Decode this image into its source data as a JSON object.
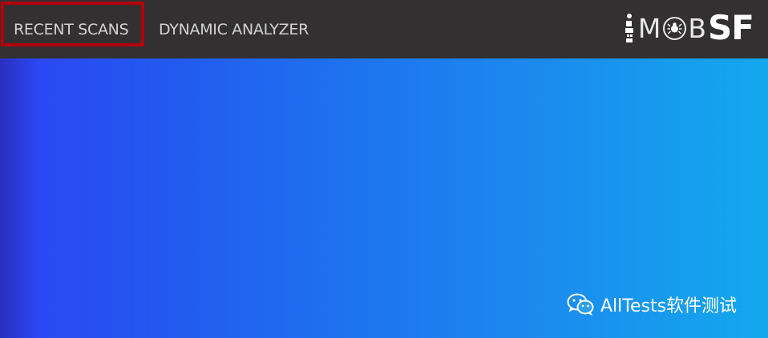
{
  "navbar": {
    "items": [
      {
        "label": "RECENT SCANS",
        "highlighted": true
      },
      {
        "label": "DYNAMIC ANALYZER",
        "highlighted": false
      }
    ],
    "logo": {
      "mob": "MOB",
      "sf": "SF"
    },
    "background_color": "#323031",
    "highlight_color": "#b3000a"
  },
  "hero": {
    "gradient_colors": [
      "#2b2fc0",
      "#2b48f4",
      "#1e72ef",
      "#13a8ee"
    ]
  },
  "watermark": {
    "icon": "wechat-icon",
    "text": "AllTests软件测试"
  }
}
